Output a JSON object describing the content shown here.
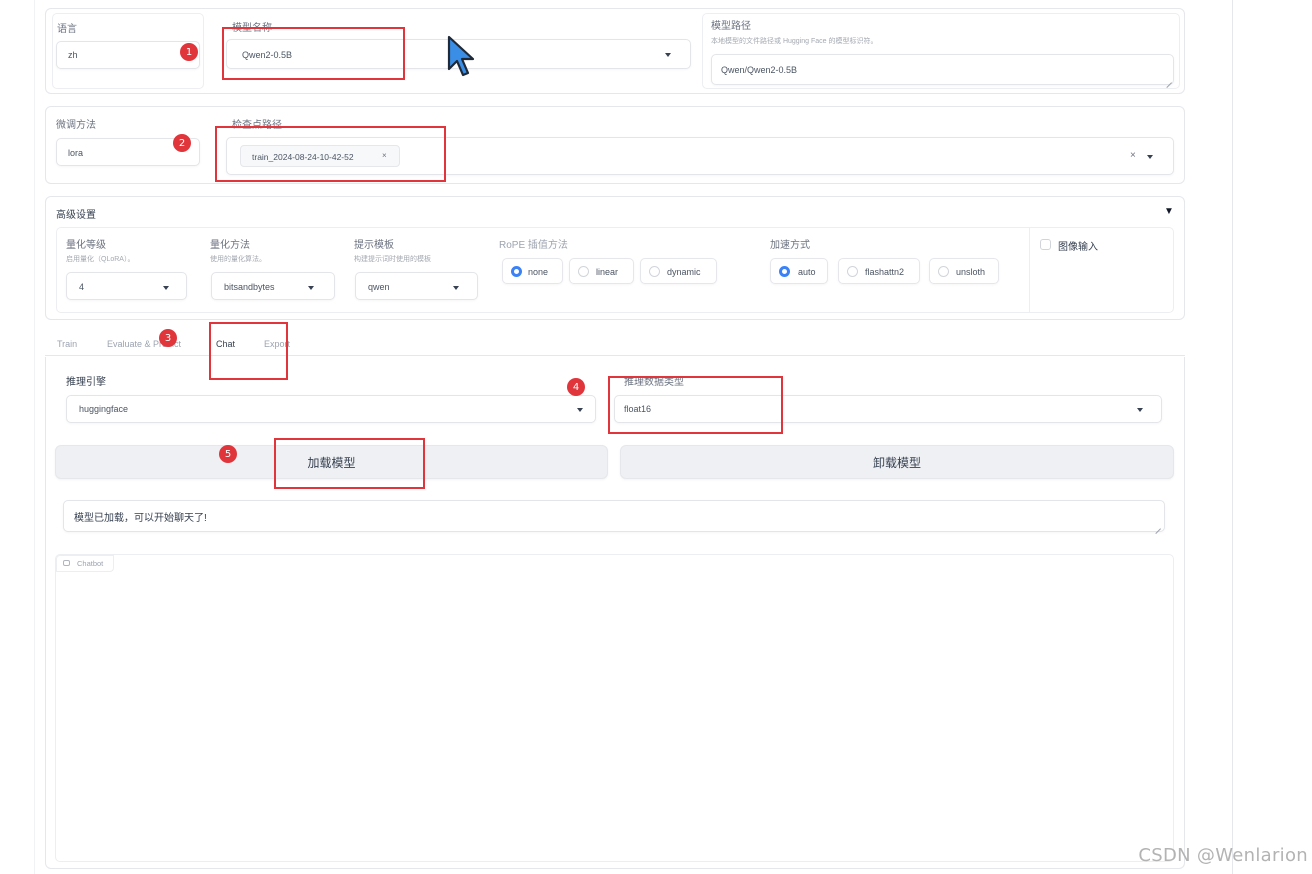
{
  "model_row": {
    "language": {
      "label": "语言",
      "value": "zh"
    },
    "model_name": {
      "label": "模型名称",
      "value": "Qwen2-0.5B"
    },
    "model_path": {
      "label": "模型路径",
      "hint": "本地模型的文件路径或 Hugging Face 的模型标识符。",
      "value": "Qwen/Qwen2-0.5B"
    }
  },
  "finetune_row": {
    "method": {
      "label": "微调方法",
      "value": "lora"
    },
    "checkpoint": {
      "label": "检查点路径",
      "chip": "train_2024-08-24-10-42-52",
      "chip_remove": "×",
      "clear": "×"
    }
  },
  "advanced": {
    "title": "高级设置",
    "toggle": "▼",
    "quant_bit": {
      "label": "量化等级",
      "hint": "启用量化（QLoRA）。",
      "value": "4"
    },
    "quant_method": {
      "label": "量化方法",
      "hint": "使用的量化算法。",
      "value": "bitsandbytes"
    },
    "template": {
      "label": "提示模板",
      "hint": "构建提示词时使用的模板",
      "value": "qwen"
    },
    "rope": {
      "label": "RoPE 插值方法",
      "options": [
        "none",
        "linear",
        "dynamic"
      ],
      "selected": "none"
    },
    "booster": {
      "label": "加速方式",
      "options": [
        "auto",
        "flashattn2",
        "unsloth"
      ],
      "selected": "auto"
    },
    "visual_input": {
      "label": "图像输入"
    }
  },
  "tabs": [
    {
      "label": "Train"
    },
    {
      "label": "Evaluate & Predict"
    },
    {
      "label": "Chat"
    },
    {
      "label": "Export"
    }
  ],
  "chat": {
    "infer_backend": {
      "label": "推理引擎",
      "value": "huggingface"
    },
    "infer_dtype": {
      "label": "推理数据类型",
      "value": "float16"
    },
    "load_button": "加载模型",
    "unload_button": "卸载模型",
    "info_text": "模型已加载，可以开始聊天了!",
    "chatbot_label": "Chatbot"
  },
  "annotations": [
    "1",
    "2",
    "3",
    "4",
    "5"
  ],
  "watermark": "CSDN @Wenlarion",
  "colors": {
    "highlight": "#e0353b",
    "accent": "#3b82f6"
  }
}
